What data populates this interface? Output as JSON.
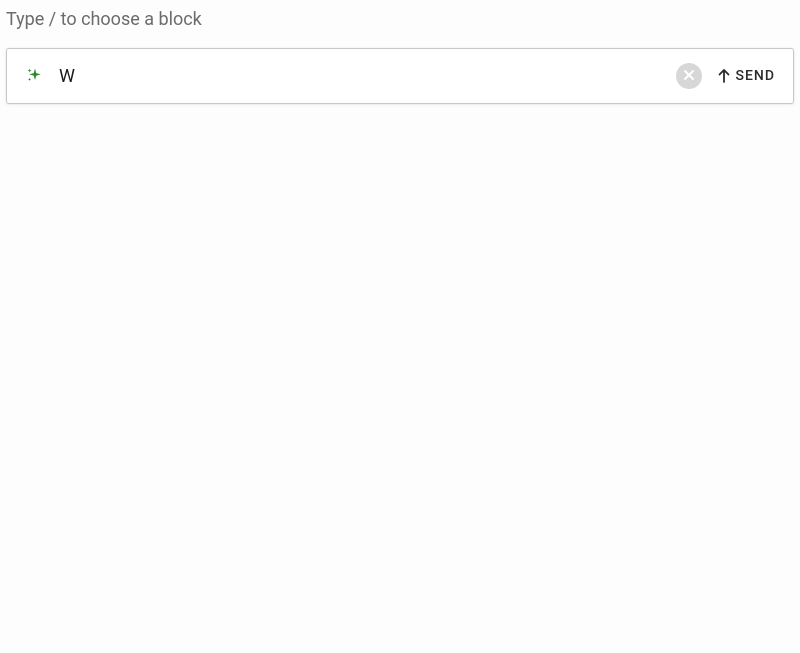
{
  "header": {
    "placeholder_hint": "Type / to choose a block"
  },
  "input_box": {
    "value": "W",
    "sparkle_color": "#2a8a2a",
    "clear_icon": "close-icon",
    "send_label": "SEND"
  }
}
